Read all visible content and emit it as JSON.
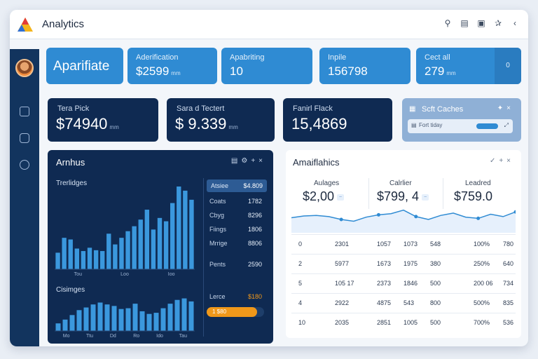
{
  "app": {
    "title": "Analytics"
  },
  "kpis": [
    {
      "label": "",
      "value": "Aparifiate",
      "unit": ""
    },
    {
      "label": "Aderification",
      "value": "$2599",
      "unit": "mm"
    },
    {
      "label": "Apabriting",
      "value": "10",
      "unit": ""
    },
    {
      "label": "Inpile",
      "value": "156798",
      "unit": ""
    },
    {
      "label": "Cect all",
      "value": "279",
      "unit": "mm",
      "button": "0"
    }
  ],
  "dark_cards": [
    {
      "label": "Tera Pick",
      "value": "$74940",
      "unit": "mm"
    },
    {
      "label": "Sara d Tectert",
      "value": "$ 9.339",
      "unit": "mm"
    },
    {
      "label": "Fanirl Flack",
      "value": "15,4869",
      "unit": ""
    }
  ],
  "cache_card": {
    "title": "Scft Caches",
    "row_label": "Fort tiday",
    "bar_fraction": 0.55
  },
  "left_panel": {
    "title": "Arnhus",
    "subtitle": "Trerlidges",
    "subtitle2": "Cisimges",
    "legend": {
      "head_label": "Atsiee",
      "head_value": "$4.809",
      "rows": [
        {
          "label": "Coats",
          "value": "1782"
        },
        {
          "label": "Cbyg",
          "value": "8296"
        },
        {
          "label": "Fiings",
          "value": "1806"
        },
        {
          "label": "Mrrige",
          "value": "8806"
        },
        {
          "label": "Pents",
          "value": "2590"
        }
      ],
      "progress_label": "Lerce",
      "progress_value": "$180",
      "progress_fill_label": "1 $80",
      "progress_fraction": 0.88
    },
    "top_axis_labels": [
      "Tou",
      "Loo",
      "Ioo"
    ],
    "bottom_axis_labels": [
      "Mo",
      "Ttu",
      "Dd",
      "Ro",
      "Ido",
      "Tau"
    ]
  },
  "right_panel": {
    "title": "Amaiflahics",
    "stats": [
      {
        "label": "Aulages",
        "value": "$2,00"
      },
      {
        "label": "Calrlier",
        "value": "$799, 4"
      },
      {
        "label": "Leadred",
        "value": "$759.0"
      }
    ],
    "table": [
      [
        "0",
        "2301",
        "1057",
        "1073",
        "548",
        "100%",
        "780"
      ],
      [
        "2",
        "5977",
        "1673",
        "1975",
        "380",
        "250%",
        "640"
      ],
      [
        "5",
        "105 17",
        "2373",
        "1846",
        "500",
        "200 06",
        "734"
      ],
      [
        "4",
        "2922",
        "4875",
        "543",
        "800",
        "500%",
        "835"
      ],
      [
        "10",
        "2035",
        "2851",
        "1005",
        "500",
        "700%",
        "536"
      ]
    ]
  },
  "colors": {
    "navy": "#0f2a52",
    "accent": "#2f8bd3",
    "orange": "#f0981a"
  },
  "chart_data": [
    {
      "type": "bar",
      "series": [
        {
          "values": [
            20,
            38,
            36,
            25,
            22,
            26,
            23,
            22,
            43,
            30,
            38,
            46,
            52,
            60,
            72,
            48,
            62,
            58,
            80,
            100,
            95,
            84
          ]
        }
      ],
      "ylim": [
        0,
        100
      ]
    },
    {
      "type": "bar",
      "series": [
        {
          "values": [
            20,
            30,
            42,
            55,
            62,
            70,
            75,
            70,
            66,
            58,
            60,
            72,
            52,
            45,
            48,
            60,
            72,
            82,
            86,
            78
          ]
        }
      ],
      "ylim": [
        0,
        100
      ]
    },
    {
      "type": "line",
      "series": [
        {
          "values": [
            42,
            48,
            50,
            46,
            36,
            30,
            44,
            52,
            56,
            68,
            46,
            36,
            50,
            58,
            44,
            40,
            54,
            46,
            62
          ]
        }
      ],
      "ylim": [
        0,
        100
      ]
    }
  ]
}
